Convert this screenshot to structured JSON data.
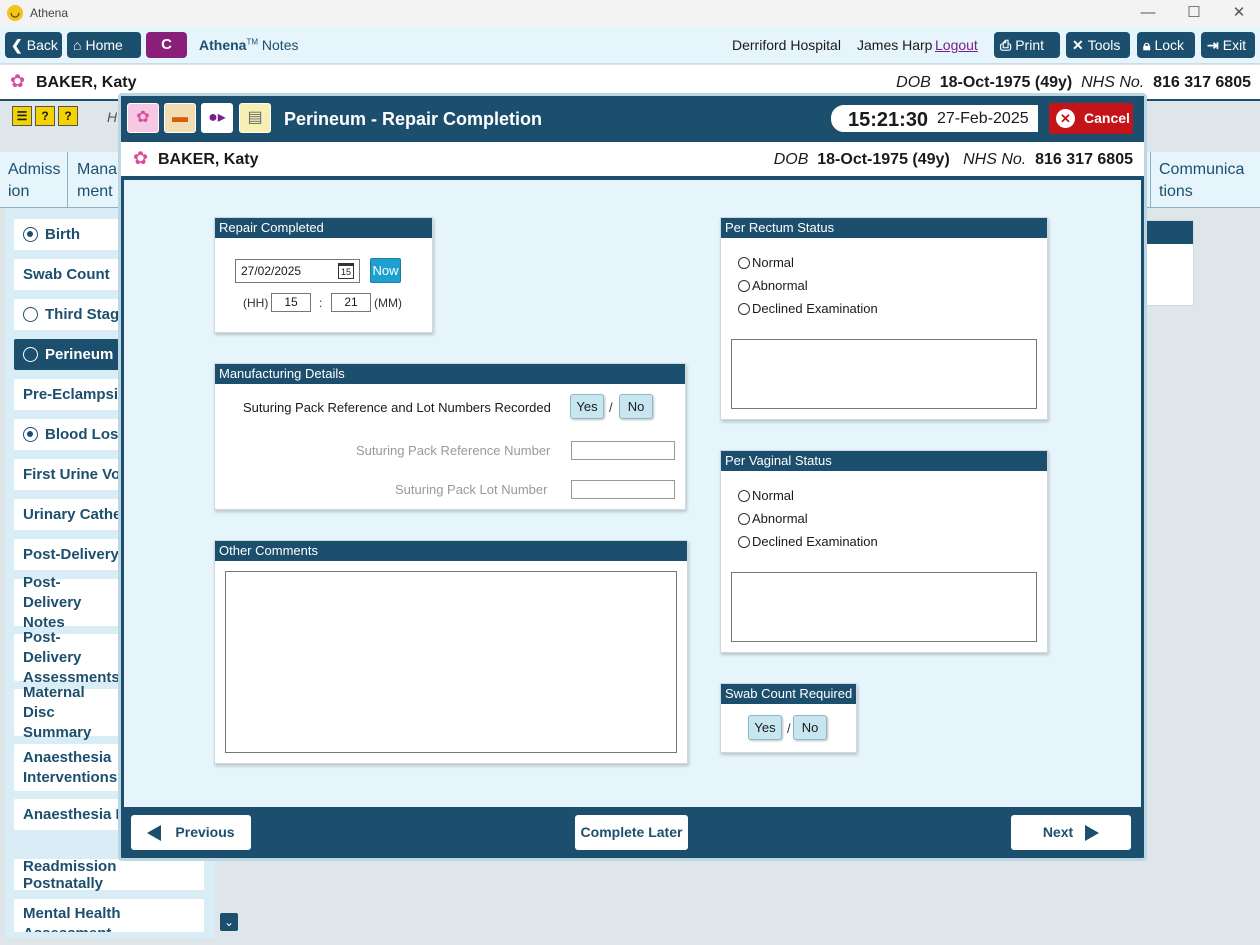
{
  "window": {
    "title": "Athena",
    "minimize": "—",
    "maximize": "☐",
    "close": "✕"
  },
  "toolbar": {
    "back": "Back",
    "home": "Home",
    "c_label": "C",
    "app_name": "Athena",
    "app_tm": "TM",
    "app_suffix": "Notes",
    "hospital": "Derriford Hospital",
    "user": "James Harp",
    "logout": "Logout",
    "print": "Print",
    "tools": "Tools",
    "lock": "Lock",
    "exit": "Exit"
  },
  "patient": {
    "name": "BAKER, Katy",
    "dob_label": "DOB",
    "dob": "18-Oct-1975 (49y)",
    "nhs_label": "NHS No.",
    "nhs": "816 317 6805"
  },
  "background": {
    "h_partial": "H",
    "tabs": [
      {
        "label": "Admiss ion"
      },
      {
        "label": "Mana ment"
      },
      {
        "label": "Communica tions"
      }
    ],
    "sidebar": [
      {
        "label": "Birth"
      },
      {
        "label": "Swab Count"
      },
      {
        "label": "Third Stage"
      },
      {
        "label": "Perineum"
      },
      {
        "label": "Pre-Eclampsia"
      },
      {
        "label": "Blood Loss"
      },
      {
        "label": "First Urine Voi"
      },
      {
        "label": "Urinary Cathe"
      },
      {
        "label": "Post-Delivery"
      },
      {
        "label": "Post-Delivery Notes"
      },
      {
        "label": "Post-Delivery Assessments"
      },
      {
        "label": "Maternal Disc Summary"
      },
      {
        "label": "Anaesthesia Interventions"
      },
      {
        "label": "Anaesthesia F"
      },
      {
        "label": "Readmission Postnatally"
      },
      {
        "label": "Mental Health Assessment"
      }
    ]
  },
  "modal": {
    "title": "Perineum - Repair Completion",
    "time": "15:21:30",
    "date": "27-Feb-2025",
    "cancel": "Cancel",
    "repair_completed": {
      "header": "Repair Completed",
      "date_value": "27/02/2025",
      "calendar_day": "15",
      "now_label": "Now",
      "hh_label": "(HH)",
      "hh_value": "15",
      "colon": ":",
      "mm_value": "21",
      "mm_label": "(MM)"
    },
    "manufacturing": {
      "header": "Manufacturing Details",
      "question": "Suturing Pack Reference and Lot Numbers Recorded",
      "yes": "Yes",
      "slash": "/",
      "no": "No",
      "ref_label": "Suturing Pack Reference Number",
      "lot_label": "Suturing Pack Lot Number"
    },
    "other_comments": {
      "header": "Other Comments"
    },
    "per_rectum": {
      "header": "Per Rectum Status",
      "options": [
        "Normal",
        "Abnormal",
        "Declined Examination"
      ]
    },
    "per_vaginal": {
      "header": "Per Vaginal Status",
      "options": [
        "Normal",
        "Abnormal",
        "Declined Examination"
      ]
    },
    "swab_count": {
      "header": "Swab Count Required",
      "yes": "Yes",
      "slash": "/",
      "no": "No"
    },
    "footer": {
      "previous": "Previous",
      "complete_later": "Complete Later",
      "next": "Next"
    }
  },
  "colors": {
    "primary": "#1c4f6e",
    "accent_purple": "#8a1f7a",
    "cancel_red": "#c5131a",
    "now_blue": "#1e9fcf",
    "background": "#e6f5fb"
  }
}
